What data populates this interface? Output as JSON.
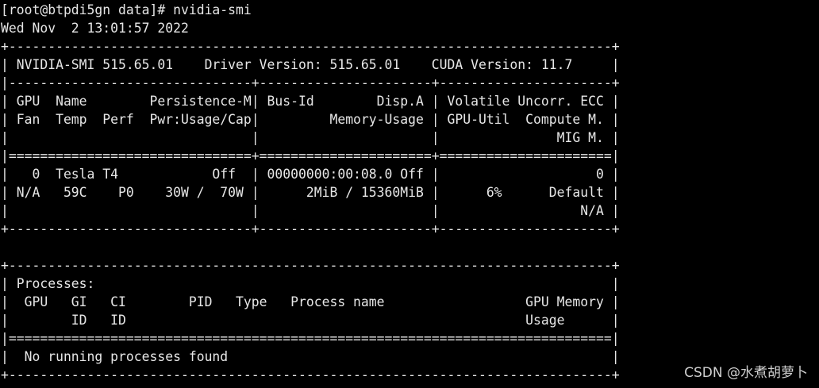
{
  "terminal": {
    "lines": [
      "[root@btpdi5gn data]# nvidia-smi",
      "Wed Nov  2 13:01:57 2022",
      "+-----------------------------------------------------------------------------+",
      "| NVIDIA-SMI 515.65.01    Driver Version: 515.65.01    CUDA Version: 11.7     |",
      "|-------------------------------+----------------------+----------------------+",
      "| GPU  Name        Persistence-M| Bus-Id        Disp.A | Volatile Uncorr. ECC |",
      "| Fan  Temp  Perf  Pwr:Usage/Cap|         Memory-Usage | GPU-Util  Compute M. |",
      "|                               |                      |               MIG M. |",
      "|===============================+======================+======================|",
      "|   0  Tesla T4            Off  | 00000000:00:08.0 Off |                    0 |",
      "| N/A   59C    P0    30W /  70W |      2MiB / 15360MiB |      6%      Default |",
      "|                               |                      |                  N/A |",
      "+-------------------------------+----------------------+----------------------+",
      "",
      "+-----------------------------------------------------------------------------+",
      "| Processes:                                                                  |",
      "|  GPU   GI   CI        PID   Type   Process name                  GPU Memory |",
      "|        ID   ID                                                   Usage      |",
      "|=============================================================================|",
      "|  No running processes found                                                 |",
      "+-----------------------------------------------------------------------------+"
    ]
  },
  "watermark": "CSDN @水煮胡萝卜",
  "colors": {
    "background": "#000000",
    "text": "#e6e6e6",
    "cursor": "#00c000"
  }
}
